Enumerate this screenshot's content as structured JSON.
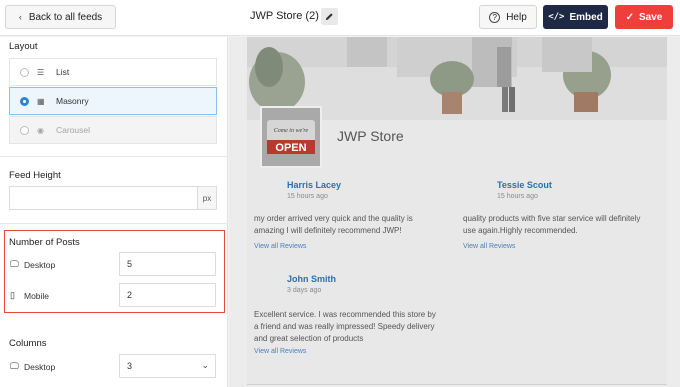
{
  "topbar": {
    "back_label": "Back to all feeds",
    "title": "JWP Store (2)",
    "help_label": "Help",
    "embed_label": "Embed",
    "save_label": "Save"
  },
  "sidebar": {
    "layout_label": "Layout",
    "layout_options": [
      {
        "label": "List",
        "icon": "list-icon",
        "selected": false,
        "disabled": false
      },
      {
        "label": "Masonry",
        "icon": "masonry-icon",
        "selected": true,
        "disabled": false
      },
      {
        "label": "Carousel",
        "icon": "carousel-icon",
        "selected": false,
        "disabled": true
      }
    ],
    "feed_height_label": "Feed Height",
    "feed_height_value": "",
    "feed_height_unit": "px",
    "num_posts_label": "Number of Posts",
    "desktop_label": "Desktop",
    "desktop_posts": "5",
    "mobile_label": "Mobile",
    "mobile_posts": "2",
    "columns_label": "Columns",
    "columns_desktop_label": "Desktop",
    "columns_desktop_value": "3"
  },
  "preview": {
    "store_name": "JWP Store",
    "sign_text": "OPEN",
    "sign_top": "Come in we're",
    "reviews": [
      {
        "name": "Harris Lacey",
        "time": "15 hours ago",
        "text_lines": [
          "my order arrived very quick and the quality is",
          "amazing I will definitely recommend JWP!"
        ],
        "link": "View all Reviews"
      },
      {
        "name": "Tessie Scout",
        "time": "15 hours ago",
        "text_lines": [
          "quality products with five star service will definitely",
          "use again.Highly recommended."
        ],
        "link": "View all Reviews"
      },
      {
        "name": "John Smith",
        "time": "3 days ago",
        "text_lines": [
          "Excellent service. I was recommended this store by",
          "a friend and was really impressed! Speedy delivery",
          "and great selection of products"
        ],
        "link": "View all Reviews"
      }
    ]
  },
  "colors": {
    "embed_bg": "#1e2a45",
    "save_bg": "#ef3f3a",
    "highlight_border": "#e24b3b",
    "reviewer_name": "#2f6fa8",
    "radio_on": "#2b86d2"
  }
}
